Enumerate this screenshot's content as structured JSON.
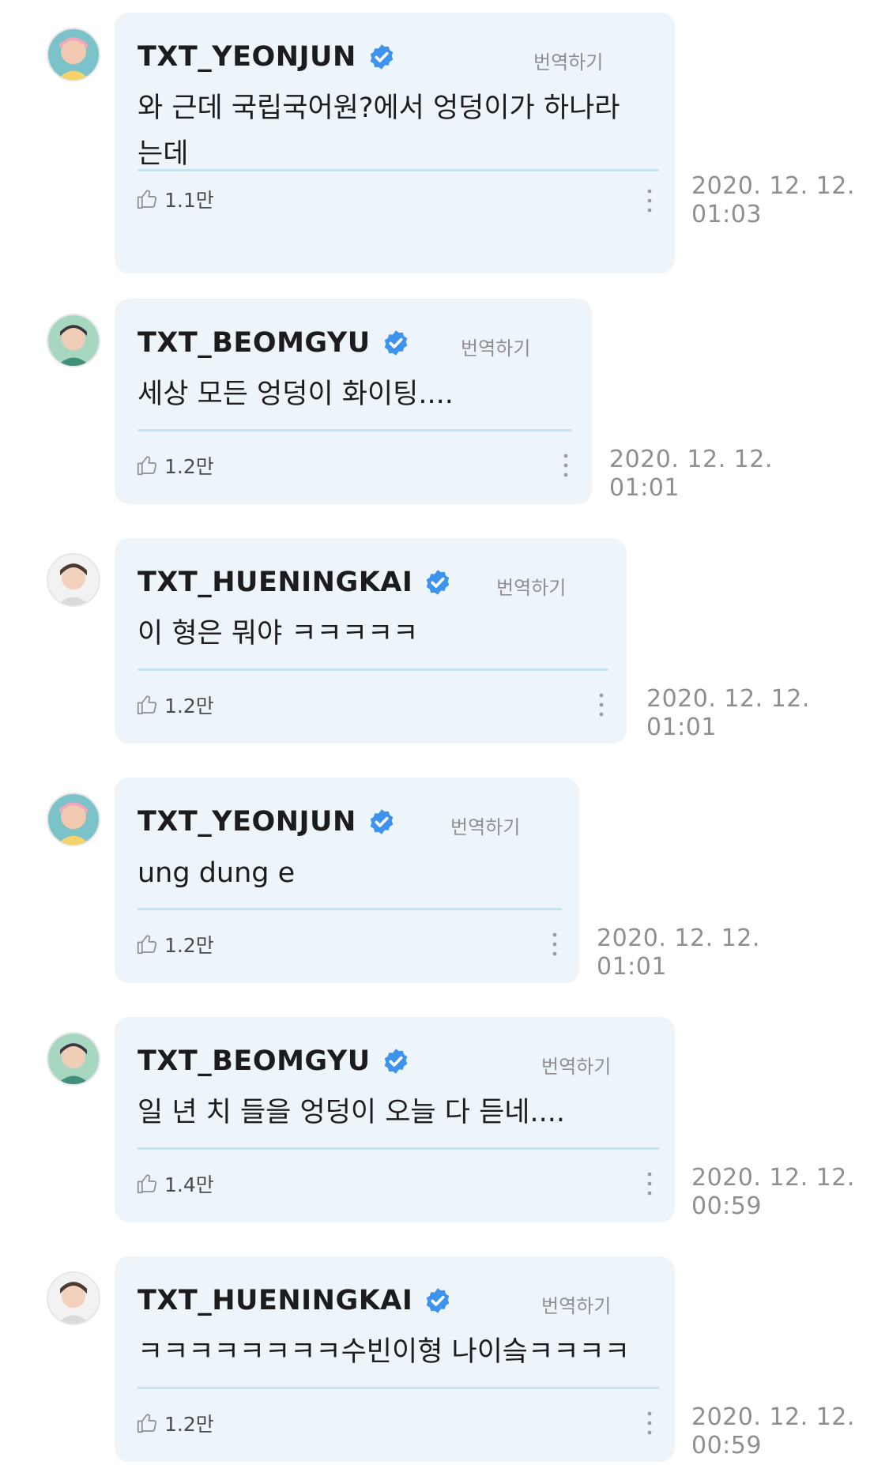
{
  "comments": [
    {
      "author": "TXT_YEONJUN",
      "translate_label": "번역하기",
      "text": "와 근데 국립국어원?에서 엉덩이가 하나라\n는데",
      "likes": "1.1만",
      "timestamp_date": "2020. 12. 12.",
      "timestamp_time": "01:03"
    },
    {
      "author": "TXT_BEOMGYU",
      "translate_label": "번역하기",
      "text": "세상 모든 엉덩이 화이팅....",
      "likes": "1.2만",
      "timestamp_date": "2020. 12. 12.",
      "timestamp_time": "01:01"
    },
    {
      "author": "TXT_HUENINGKAI",
      "translate_label": "번역하기",
      "text": "이 형은 뭐야 ㅋㅋㅋㅋㅋ",
      "likes": "1.2만",
      "timestamp_date": "2020. 12. 12.",
      "timestamp_time": "01:01"
    },
    {
      "author": "TXT_YEONJUN",
      "translate_label": "번역하기",
      "text": "ung dung e",
      "likes": "1.2만",
      "timestamp_date": "2020. 12. 12.",
      "timestamp_time": "01:01"
    },
    {
      "author": "TXT_BEOMGYU",
      "translate_label": "번역하기",
      "text": "일 년 치 들을 엉덩이 오늘 다 듣네....",
      "likes": "1.4만",
      "timestamp_date": "2020. 12. 12.",
      "timestamp_time": "00:59"
    },
    {
      "author": "TXT_HUENINGKAI",
      "translate_label": "번역하기",
      "text": "ㅋㅋㅋㅋㅋㅋㅋㅋ수빈이형 나이슼ㅋㅋㅋㅋ",
      "likes": "1.2만",
      "timestamp_date": "2020. 12. 12.",
      "timestamp_time": "00:59"
    }
  ],
  "colors": {
    "bubble": "#edf5fb",
    "divider": "#c6e4ee",
    "verified": "#3d93ee",
    "text": "#1c1c1e",
    "muted": "#8e8e93"
  },
  "icons": {
    "verified": "verified-badge-icon",
    "like": "thumbs-up-icon",
    "more": "more-vertical-icon"
  }
}
